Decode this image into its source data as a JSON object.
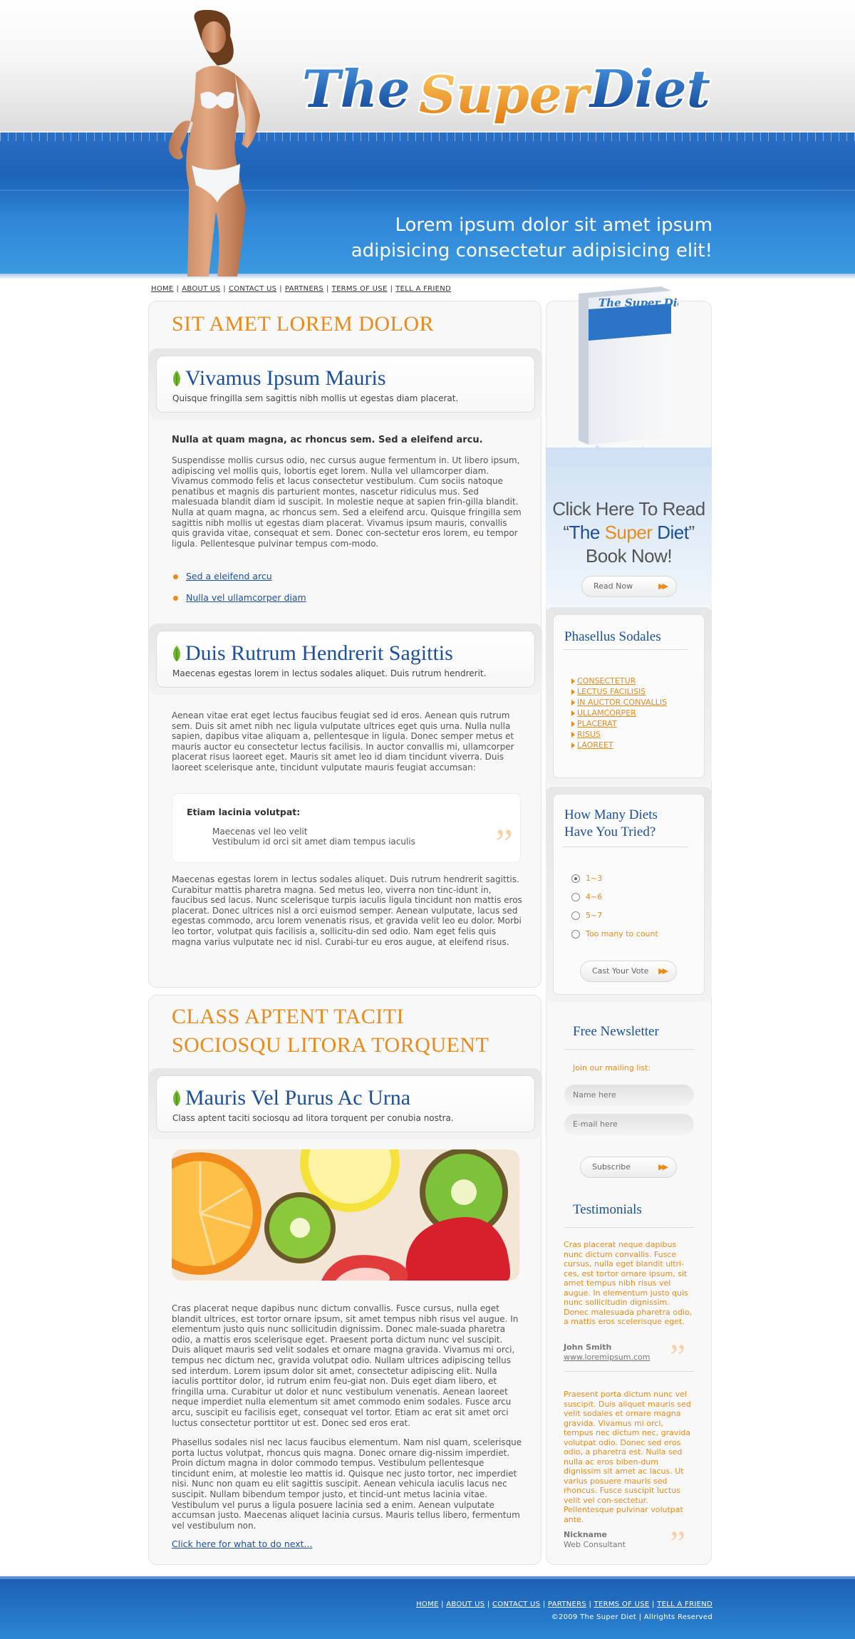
{
  "header": {
    "logo_text": "The Super Diet",
    "tagline_line1": "Lorem ipsum dolor sit amet ipsum",
    "tagline_line2": "adipisicing consectetur adipisicing elit!"
  },
  "top_nav": [
    "HOME",
    "ABOUT US",
    "CONTACT US",
    "PARTNERS",
    "TERMS OF USE",
    "TELL A FRIEND"
  ],
  "section1": {
    "title": "SIT AMET LOREM DOLOR",
    "post1": {
      "title": "Vivamus Ipsum Mauris",
      "subtitle": "Quisque fringilla sem sagittis nibh mollis ut egestas diam placerat.",
      "lead": "Nulla at quam magna, ac rhoncus sem. Sed a eleifend arcu.",
      "body": "Suspendisse mollis cursus odio, nec cursus augue fermentum in. Ut libero ipsum, adipiscing vel mollis quis, lobortis eget lorem. Nulla vel ullamcorper diam. Vivamus commodo felis et lacus consectetur vestibulum. Cum sociis natoque penatibus et magnis dis parturient montes, nascetur ridiculus mus. Sed malesuada blandit diam id suscipit. In molestie neque at sapien frin-gilla blandit. Nulla at quam magna, ac rhoncus sem. Sed a eleifend arcu. Quisque fringilla sem sagittis nibh mollis ut egestas diam placerat. Vivamus ipsum mauris, convallis quis gravida vitae, consequat et sem. Donec con-sectetur eros lorem, eu tempor ligula. Pellentesque pulvinar tempus com-modo.",
      "links": [
        "Sed a eleifend arcu",
        "Nulla vel ullamcorper diam"
      ]
    },
    "post2": {
      "title": "Duis Rutrum Hendrerit Sagittis",
      "subtitle": "Maecenas egestas lorem in lectus sodales aliquet. Duis rutrum hendrerit.",
      "body1": "Aenean vitae erat eget lectus faucibus feugiat sed id eros. Aenean quis rutrum sem. Duis sit amet nibh nec ligula vulputate ultrices eget quis urna. Nulla nulla sapien, dapibus vitae aliquam a, pellentesque in ligula. Donec semper metus et mauris auctor eu consectetur lectus facilisis. In auctor convallis mi, ullamcorper placerat risus laoreet eget. Mauris sit amet leo id diam tincidunt viverra. Duis laoreet scelerisque ante, tincidunt vulputate mauris feugiat accumsan:",
      "quote_heading": "Etiam lacinia volutpat:",
      "quote_line1": "Maecenas vel leo velit",
      "quote_line2": "Vestibulum id orci sit amet diam tempus iaculis",
      "body2": "Maecenas egestas lorem in lectus sodales aliquet. Duis rutrum hendrerit sagittis. Curabitur mattis pharetra magna. Sed metus leo, viverra non tinc-idunt in, faucibus sed lacus. Nunc scelerisque turpis iaculis ligula tincidunt non mattis eros placerat. Donec ultrices nisl a orci euismod semper. Aenean vulputate, lacus sed egestas commodo, arcu lorem venenatis risus, et gravida velit leo eu dolor. Morbi leo tortor, volutpat quis facilisis a, sollicitu-din sed odio. Nam eget felis quis magna varius vulputate nec id nisl. Curabi-tur eu eros augue, at eleifend risus."
    }
  },
  "section2": {
    "title_line1": "CLASS APTENT TACITI",
    "title_line2": "SOCIOSQU LITORA TORQUENT",
    "post": {
      "title": "Mauris Vel Purus Ac Urna",
      "subtitle": "Class aptent taciti sociosqu ad litora torquent per conubia nostra.",
      "body1": "Cras placerat neque dapibus nunc dictum convallis. Fusce cursus, nulla eget blandit ultrices, est tortor ornare ipsum, sit amet tempus nibh risus vel augue. In elementum justo quis nunc sollicitudin dignissim. Donec male-suada pharetra odio, a mattis eros scelerisque eget. Praesent porta dictum nunc vel suscipit. Duis aliquet mauris sed velit sodales et ornare magna gravida. Vivamus mi orci, tempus nec dictum nec, gravida volutpat odio. Nullam ultrices adipiscing tellus sed interdum. Lorem ipsum dolor sit amet, consectetur adipiscing elit. Nulla iaculis porttitor dolor, id rutrum enim feu-giat non. Duis eget diam libero, et fringilla urna. Curabitur ut dolor et nunc vestibulum venenatis. Aenean laoreet neque imperdiet nulla elementum sit amet commodo enim sodales. Fusce arcu arcu, suscipit eu facilisis eget, consequat vel tortor. Etiam ac erat sit amet orci luctus consectetur porttitor ut est. Donec sed eros erat.",
      "body2": "Phasellus sodales nisl nec lacus faucibus elementum. Nam nisl quam, scelerisque porta luctus volutpat, rhoncus quis magna. Donec ornare dig-nissim imperdiet. Proin dictum magna in dolor commodo tempus. Vestibulum pellentesque tincidunt enim, at molestie leo mattis id. Quisque nec justo tortor, nec imperdiet nisi. Nunc non quam eu elit sagittis suscipit. Aenean vehicula iaculis lacus nec suscipit. Nullam bibendum tempor justo, et tincid-unt metus lacinia vitae. Vestibulum vel purus a ligula posuere lacinia sed a enim. Aenean vulputate accumsan justo. Maecenas aliquet lacinia cursus. Mauris tellus libero, fermentum vel vestibulum non.",
      "more_link": "Click here for what to do next..."
    }
  },
  "sidebar": {
    "book_cover_title": "The Super Diet",
    "cta_line1": "Click Here To Read",
    "cta_quote_open": "“",
    "cta_the": "The ",
    "cta_super": "Super",
    "cta_diet": " Diet",
    "cta_quote_close": "”",
    "cta_line3": "Book Now!",
    "read_now": "Read Now",
    "categories_title": "Phasellus Sodales",
    "categories": [
      "CONSECTETUR",
      "LECTUS FACILISIS",
      "IN AUCTOR CONVALLIS",
      "ULLAMCORPER",
      "PLACERAT",
      "RISUS",
      "LAOREET"
    ],
    "poll_title_line1": "How Many Diets",
    "poll_title_line2": "Have You Tried?",
    "poll_options": [
      "1~3",
      "4~6",
      "5~7",
      "Too many to count"
    ],
    "poll_selected": 0,
    "vote_button": "Cast Your Vote",
    "newsletter_title": "Free Newsletter",
    "newsletter_join": "Join our mailing list:",
    "name_placeholder": "Name here",
    "email_placeholder": "E-mail here",
    "subscribe_button": "Subscribe",
    "testimonials_title": "Testimonials",
    "testimonial1": {
      "text": "Cras placerat neque dapibus nunc dictum convallis. Fusce cursus, nulla eget blandit ultri-ces, est tortor ornare ipsum, sit amet tempus nibh risus vel augue. In elementum justo quis nunc sollicitudin dignissim. Donec malesuada pharetra odio, a mattis eros scelerisque eget.",
      "name": "John Smith",
      "url": "www.loremipsum.com"
    },
    "testimonial2": {
      "text": "Praesent porta dictum nunc vel suscipit. Duis aliquet mauris sed velit sodales et ornare magna gravida. Vivamus mi orci, tempus nec dictum nec, gravida volutpat odio. Donec sed eros odio, a pharetra est. Nulla sed nulla ac eros biben-dum dignissim sit amet ac lacus. Ut varius posuere mauris sed rhoncus. Fusce suscipit luctus velit vel con-sectetur. Pellentesque pulvinar volutpat ante.",
      "name": "Nickname",
      "role": "Web Consultant"
    }
  },
  "footer": {
    "nav": [
      "HOME",
      "ABOUT US",
      "CONTACT US",
      "PARTNERS",
      "TERMS OF USE",
      "TELL A FRIEND"
    ],
    "copyright": "©2009 The Super Diet | Allrights Reserved"
  },
  "colors": {
    "brand_blue": "#1b4f9c",
    "accent_orange": "#e98a1c",
    "header_band": "#2a75c9"
  }
}
